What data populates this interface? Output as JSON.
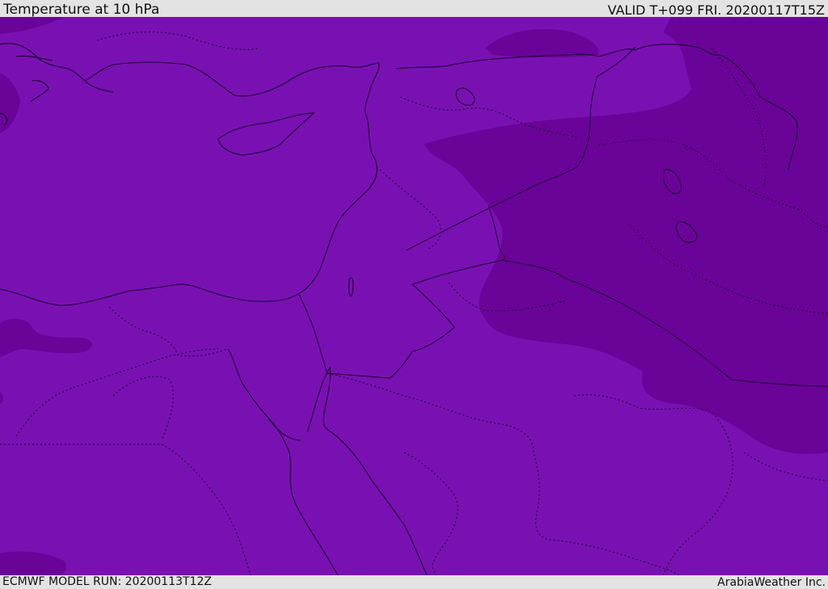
{
  "header": {
    "title": "Temperature at 10 hPa",
    "valid": "VALID T+099 FRI. 20200117T15Z"
  },
  "footer": {
    "model_run": "ECMWF MODEL RUN: 20200113T12Z",
    "brand": "ArabiaWeather Inc."
  },
  "map": {
    "colors": {
      "base_field": "#7911b2",
      "cold_field": "#6a0398",
      "coastline": "#1a0033"
    }
  }
}
